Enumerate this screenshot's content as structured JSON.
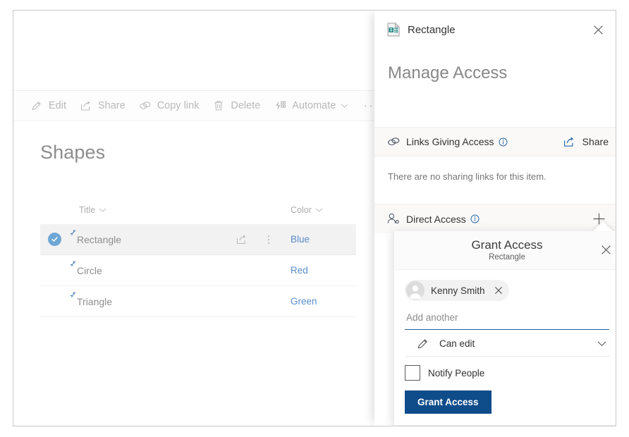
{
  "list_view": {
    "command_bar": {
      "items": [
        {
          "label": "Edit",
          "icon": "pencil-icon",
          "has_caret": false
        },
        {
          "label": "Share",
          "icon": "share-icon",
          "has_caret": false
        },
        {
          "label": "Copy link",
          "icon": "link-icon",
          "has_caret": false
        },
        {
          "label": "Delete",
          "icon": "trash-icon",
          "has_caret": false
        },
        {
          "label": "Automate",
          "icon": "automate-icon",
          "has_caret": true
        }
      ],
      "overflow_label": "···"
    },
    "title": "Shapes",
    "columns": [
      {
        "label": "Title"
      },
      {
        "label": "Color"
      }
    ],
    "rows": [
      {
        "title": "Rectangle",
        "color": "Blue",
        "selected": true
      },
      {
        "title": "Circle",
        "color": "Red",
        "selected": false
      },
      {
        "title": "Triangle",
        "color": "Green",
        "selected": false
      }
    ]
  },
  "panel": {
    "item_icon": "sharepoint-list-item-icon",
    "item_title": "Rectangle",
    "close_label": "✕",
    "heading": "Manage Access",
    "links_section": {
      "icon": "link-icon",
      "label": "Links Giving Access",
      "info_icon": "info-icon",
      "action_label": "Share",
      "action_icon": "share-icon",
      "empty_text": "There are no sharing links for this item."
    },
    "direct_section": {
      "icon": "people-icon",
      "label": "Direct Access",
      "info_icon": "info-icon",
      "add_label": "+"
    }
  },
  "grant_access_callout": {
    "title": "Grant Access",
    "subtitle": "Rectangle",
    "close_label": "✕",
    "people": [
      {
        "name": "Kenny Smith",
        "remove_label": "✕",
        "avatar_icon": "person-avatar-icon"
      }
    ],
    "add_another_value": "",
    "add_another_placeholder": "Add another",
    "permission": {
      "icon": "pencil-icon",
      "value": "Can edit",
      "caret_icon": "chevron-down-icon"
    },
    "notify": {
      "label": "Notify People",
      "checked": false
    },
    "submit_label": "Grant Access"
  },
  "colors": {
    "accent_blue": "#0f4c8a",
    "link_blue": "#5a8dc8",
    "info_blue": "#2a67a8",
    "selection_blue": "#6ea7d6",
    "muted_text": "#8e8e8e"
  }
}
